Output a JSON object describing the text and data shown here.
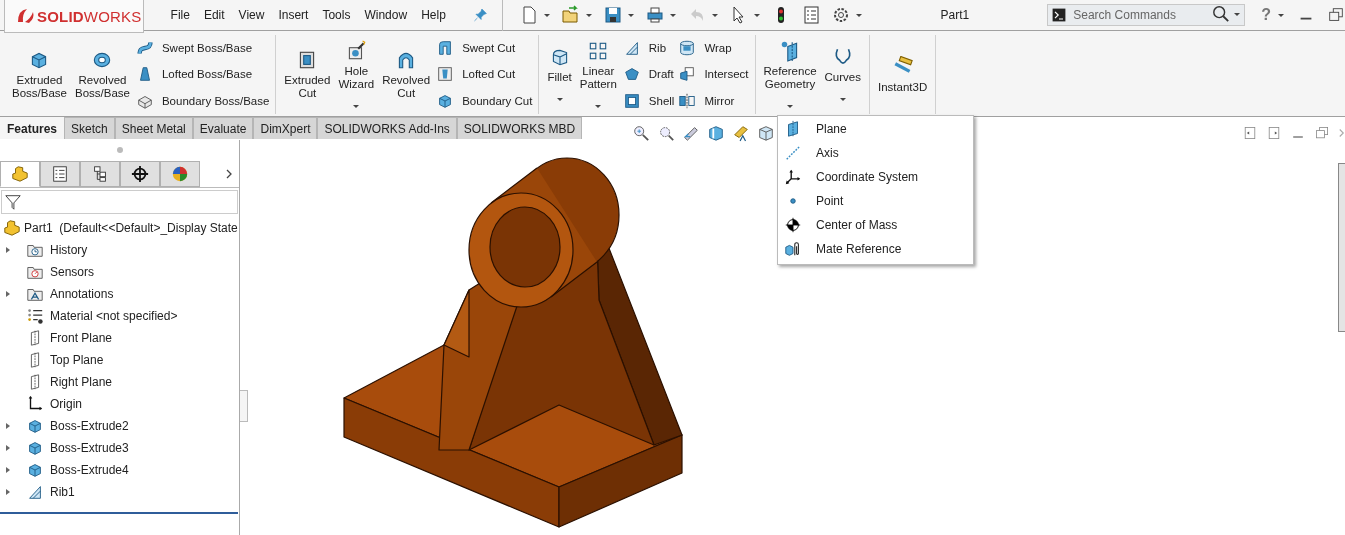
{
  "top_bar": {
    "logo": "**SOLID**WORKS",
    "menus": [
      "File",
      "Edit",
      "View",
      "Insert",
      "Tools",
      "Window",
      "Help"
    ],
    "quick_access": [
      {
        "dropdown": true,
        "disabled": false
      },
      {
        "dropdown": true,
        "disabled": false
      },
      {
        "dropdown": true,
        "disabled": false
      },
      {
        "dropdown": true,
        "disabled": false
      },
      {
        "dropdown": true,
        "disabled": true
      },
      {
        "dropdown": true,
        "disabled": false
      },
      {
        "dropdown": false,
        "disabled": false
      },
      {
        "dropdown": false,
        "disabled": false
      },
      {
        "dropdown": true,
        "disabled": false
      }
    ],
    "document_title": "Part1",
    "search": {
      "placeholder": "Search Commands"
    },
    "help": "?"
  },
  "ribbon": {
    "groups": [
      {
        "items": [
          {
            "kind": "large",
            "label": "Extruded Boss/Base",
            "dropdown": false
          },
          {
            "kind": "large",
            "label": "Revolved Boss/Base",
            "dropdown": false
          },
          {
            "kind": "stack",
            "labels": [
              "Swept Boss/Base",
              "Lofted Boss/Base",
              "Boundary Boss/Base"
            ]
          }
        ]
      },
      {
        "items": [
          {
            "kind": "large",
            "label": "Extruded Cut",
            "dropdown": false
          },
          {
            "kind": "large",
            "label": "Hole Wizard",
            "dropdown": true
          },
          {
            "kind": "large",
            "label": "Revolved Cut",
            "dropdown": false
          },
          {
            "kind": "stack",
            "labels": [
              "Swept Cut",
              "Lofted Cut",
              "Boundary Cut"
            ]
          }
        ]
      },
      {
        "items": [
          {
            "kind": "large",
            "label": "Fillet",
            "dropdown": true
          },
          {
            "kind": "large",
            "label": "Linear Pattern",
            "dropdown": true
          },
          {
            "kind": "stack",
            "labels": [
              "Rib",
              "Draft",
              "Shell"
            ]
          },
          {
            "kind": "stack",
            "labels": [
              "Wrap",
              "Intersect",
              "Mirror"
            ]
          }
        ]
      },
      {
        "items": [
          {
            "kind": "large",
            "label": "Reference Geometry",
            "dropdown": true
          },
          {
            "kind": "large",
            "label": "Curves",
            "dropdown": true
          }
        ]
      },
      {
        "items": [
          {
            "kind": "large",
            "label": "Instant3D",
            "dropdown": false
          }
        ]
      }
    ]
  },
  "command_tabs": [
    {
      "label": "Features",
      "selected": true
    },
    {
      "label": "Sketch",
      "selected": false
    },
    {
      "label": "Sheet Metal",
      "selected": false
    },
    {
      "label": "Evaluate",
      "selected": false
    },
    {
      "label": "DimXpert",
      "selected": false
    },
    {
      "label": "SOLIDWORKS Add-Ins",
      "selected": false
    },
    {
      "label": "SOLIDWORKS MBD",
      "selected": false
    }
  ],
  "feature_manager": {
    "tabs": [
      {
        "selected": true
      },
      {
        "selected": false
      },
      {
        "selected": false
      },
      {
        "selected": false
      },
      {
        "selected": false
      }
    ],
    "tree": {
      "label": "Part1  (Default<<Default>_Display State",
      "children": [
        {
          "label": "History",
          "expandable": true
        },
        {
          "label": "Sensors",
          "expandable": false
        },
        {
          "label": "Annotations",
          "expandable": true
        },
        {
          "label": "Material <not specified>",
          "expandable": false
        },
        {
          "label": "Front Plane",
          "expandable": false
        },
        {
          "label": "Top Plane",
          "expandable": false
        },
        {
          "label": "Right Plane",
          "expandable": false
        },
        {
          "label": "Origin",
          "expandable": false
        },
        {
          "label": "Boss-Extrude2",
          "expandable": true
        },
        {
          "label": "Boss-Extrude3",
          "expandable": true
        },
        {
          "label": "Boss-Extrude4",
          "expandable": true
        },
        {
          "label": "Rib1",
          "expandable": true
        }
      ]
    }
  },
  "reference_geometry_menu": [
    "Plane",
    "Axis",
    "Coordinate System",
    "Point",
    "Center of Mass",
    "Mate Reference"
  ]
}
